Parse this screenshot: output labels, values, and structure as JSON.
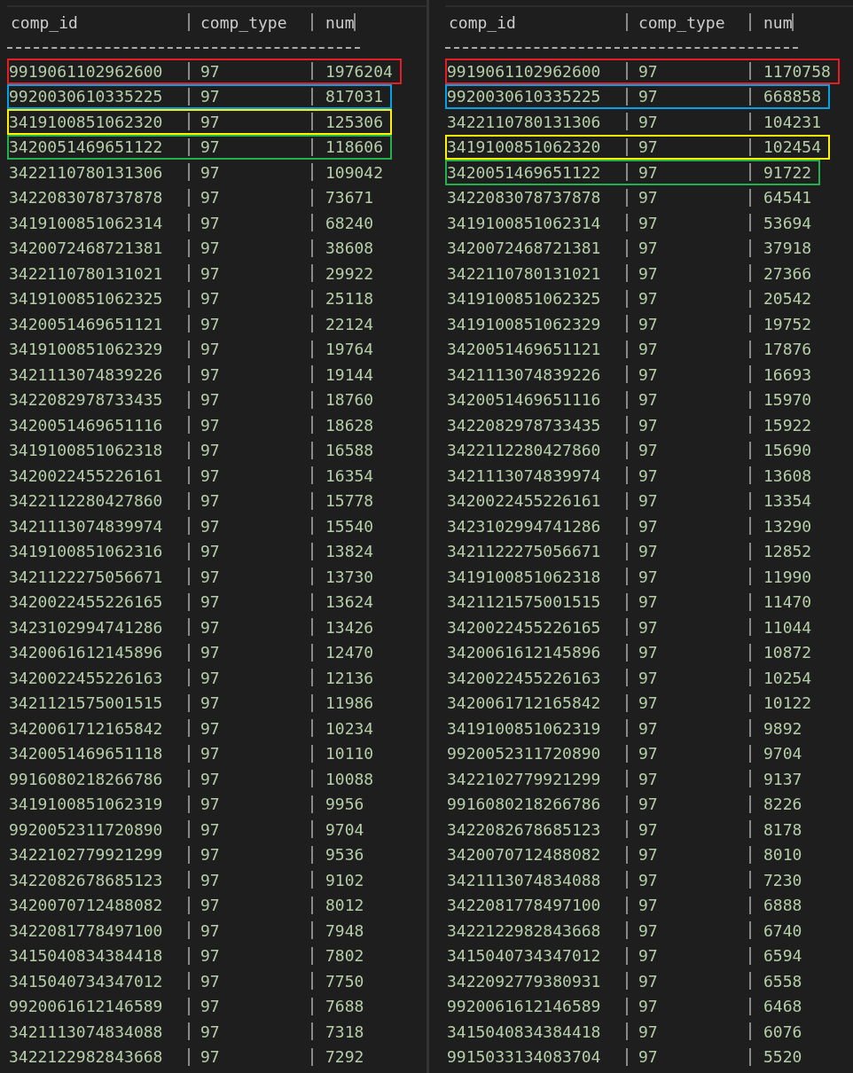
{
  "panes": [
    {
      "columns": [
        "comp_id",
        "comp_type",
        "num"
      ],
      "rows": [
        {
          "comp_id": "9919061102962600",
          "comp_type": "97",
          "num": "1976204",
          "color": "#e81c24"
        },
        {
          "comp_id": "9920030610335225",
          "comp_type": "97",
          "num": "817031",
          "color": "#00a2e8"
        },
        {
          "comp_id": "3419100851062320",
          "comp_type": "97",
          "num": "125306",
          "color": "#fff200"
        },
        {
          "comp_id": "3420051469651122",
          "comp_type": "97",
          "num": "118606",
          "color": "#22b14c"
        },
        {
          "comp_id": "3422110780131306",
          "comp_type": "97",
          "num": "109042"
        },
        {
          "comp_id": "3422083078737878",
          "comp_type": "97",
          "num": "73671"
        },
        {
          "comp_id": "3419100851062314",
          "comp_type": "97",
          "num": "68240"
        },
        {
          "comp_id": "3420072468721381",
          "comp_type": "97",
          "num": "38608"
        },
        {
          "comp_id": "3422110780131021",
          "comp_type": "97",
          "num": "29922"
        },
        {
          "comp_id": "3419100851062325",
          "comp_type": "97",
          "num": "25118"
        },
        {
          "comp_id": "3420051469651121",
          "comp_type": "97",
          "num": "22124"
        },
        {
          "comp_id": "3419100851062329",
          "comp_type": "97",
          "num": "19764"
        },
        {
          "comp_id": "3421113074839226",
          "comp_type": "97",
          "num": "19144"
        },
        {
          "comp_id": "3422082978733435",
          "comp_type": "97",
          "num": "18760"
        },
        {
          "comp_id": "3420051469651116",
          "comp_type": "97",
          "num": "18628"
        },
        {
          "comp_id": "3419100851062318",
          "comp_type": "97",
          "num": "16588"
        },
        {
          "comp_id": "3420022455226161",
          "comp_type": "97",
          "num": "16354"
        },
        {
          "comp_id": "3422112280427860",
          "comp_type": "97",
          "num": "15778"
        },
        {
          "comp_id": "3421113074839974",
          "comp_type": "97",
          "num": "15540"
        },
        {
          "comp_id": "3419100851062316",
          "comp_type": "97",
          "num": "13824"
        },
        {
          "comp_id": "3421122275056671",
          "comp_type": "97",
          "num": "13730"
        },
        {
          "comp_id": "3420022455226165",
          "comp_type": "97",
          "num": "13624"
        },
        {
          "comp_id": "3423102994741286",
          "comp_type": "97",
          "num": "13426"
        },
        {
          "comp_id": "3420061612145896",
          "comp_type": "97",
          "num": "12470"
        },
        {
          "comp_id": "3420022455226163",
          "comp_type": "97",
          "num": "12136"
        },
        {
          "comp_id": "3421121575001515",
          "comp_type": "97",
          "num": "11986"
        },
        {
          "comp_id": "3420061712165842",
          "comp_type": "97",
          "num": "10234"
        },
        {
          "comp_id": "3420051469651118",
          "comp_type": "97",
          "num": "10110"
        },
        {
          "comp_id": "9916080218266786",
          "comp_type": "97",
          "num": "10088"
        },
        {
          "comp_id": "3419100851062319",
          "comp_type": "97",
          "num": "9956"
        },
        {
          "comp_id": "9920052311720890",
          "comp_type": "97",
          "num": "9704"
        },
        {
          "comp_id": "3422102779921299",
          "comp_type": "97",
          "num": "9536"
        },
        {
          "comp_id": "3422082678685123",
          "comp_type": "97",
          "num": "9102"
        },
        {
          "comp_id": "3420070712488082",
          "comp_type": "97",
          "num": "8012"
        },
        {
          "comp_id": "3422081778497100",
          "comp_type": "97",
          "num": "7948"
        },
        {
          "comp_id": "3415040834384418",
          "comp_type": "97",
          "num": "7802"
        },
        {
          "comp_id": "3415040734347012",
          "comp_type": "97",
          "num": "7750"
        },
        {
          "comp_id": "9920061612146589",
          "comp_type": "97",
          "num": "7688"
        },
        {
          "comp_id": "3421113074834088",
          "comp_type": "97",
          "num": "7318"
        },
        {
          "comp_id": "3422122982843668",
          "comp_type": "97",
          "num": "7292"
        }
      ]
    },
    {
      "columns": [
        "comp_id",
        "comp_type",
        "num"
      ],
      "rows": [
        {
          "comp_id": "9919061102962600",
          "comp_type": "97",
          "num": "1170758",
          "color": "#e81c24"
        },
        {
          "comp_id": "9920030610335225",
          "comp_type": "97",
          "num": "668858",
          "color": "#00a2e8"
        },
        {
          "comp_id": "3422110780131306",
          "comp_type": "97",
          "num": "104231"
        },
        {
          "comp_id": "3419100851062320",
          "comp_type": "97",
          "num": "102454",
          "color": "#fff200"
        },
        {
          "comp_id": "3420051469651122",
          "comp_type": "97",
          "num": "91722",
          "color": "#22b14c"
        },
        {
          "comp_id": "3422083078737878",
          "comp_type": "97",
          "num": "64541"
        },
        {
          "comp_id": "3419100851062314",
          "comp_type": "97",
          "num": "53694"
        },
        {
          "comp_id": "3420072468721381",
          "comp_type": "97",
          "num": "37918"
        },
        {
          "comp_id": "3422110780131021",
          "comp_type": "97",
          "num": "27366"
        },
        {
          "comp_id": "3419100851062325",
          "comp_type": "97",
          "num": "20542"
        },
        {
          "comp_id": "3419100851062329",
          "comp_type": "97",
          "num": "19752"
        },
        {
          "comp_id": "3420051469651121",
          "comp_type": "97",
          "num": "17876"
        },
        {
          "comp_id": "3421113074839226",
          "comp_type": "97",
          "num": "16693"
        },
        {
          "comp_id": "3420051469651116",
          "comp_type": "97",
          "num": "15970"
        },
        {
          "comp_id": "3422082978733435",
          "comp_type": "97",
          "num": "15922"
        },
        {
          "comp_id": "3422112280427860",
          "comp_type": "97",
          "num": "15690"
        },
        {
          "comp_id": "3421113074839974",
          "comp_type": "97",
          "num": "13608"
        },
        {
          "comp_id": "3420022455226161",
          "comp_type": "97",
          "num": "13354"
        },
        {
          "comp_id": "3423102994741286",
          "comp_type": "97",
          "num": "13290"
        },
        {
          "comp_id": "3421122275056671",
          "comp_type": "97",
          "num": "12852"
        },
        {
          "comp_id": "3419100851062318",
          "comp_type": "97",
          "num": "11990"
        },
        {
          "comp_id": "3421121575001515",
          "comp_type": "97",
          "num": "11470"
        },
        {
          "comp_id": "3420022455226165",
          "comp_type": "97",
          "num": "11044"
        },
        {
          "comp_id": "3420061612145896",
          "comp_type": "97",
          "num": "10872"
        },
        {
          "comp_id": "3420022455226163",
          "comp_type": "97",
          "num": "10254"
        },
        {
          "comp_id": "3420061712165842",
          "comp_type": "97",
          "num": "10122"
        },
        {
          "comp_id": "3419100851062319",
          "comp_type": "97",
          "num": "9892"
        },
        {
          "comp_id": "9920052311720890",
          "comp_type": "97",
          "num": "9704"
        },
        {
          "comp_id": "3422102779921299",
          "comp_type": "97",
          "num": "9137"
        },
        {
          "comp_id": "9916080218266786",
          "comp_type": "97",
          "num": "8226"
        },
        {
          "comp_id": "3422082678685123",
          "comp_type": "97",
          "num": "8178"
        },
        {
          "comp_id": "3420070712488082",
          "comp_type": "97",
          "num": "8010"
        },
        {
          "comp_id": "3421113074834088",
          "comp_type": "97",
          "num": "7230"
        },
        {
          "comp_id": "3422081778497100",
          "comp_type": "97",
          "num": "6888"
        },
        {
          "comp_id": "3422122982843668",
          "comp_type": "97",
          "num": "6740"
        },
        {
          "comp_id": "3415040734347012",
          "comp_type": "97",
          "num": "6594"
        },
        {
          "comp_id": "3422092779380931",
          "comp_type": "97",
          "num": "6558"
        },
        {
          "comp_id": "9920061612146589",
          "comp_type": "97",
          "num": "6468"
        },
        {
          "comp_id": "3415040834384418",
          "comp_type": "97",
          "num": "6076"
        },
        {
          "comp_id": "9915033134083704",
          "comp_type": "97",
          "num": "5520"
        }
      ]
    }
  ]
}
